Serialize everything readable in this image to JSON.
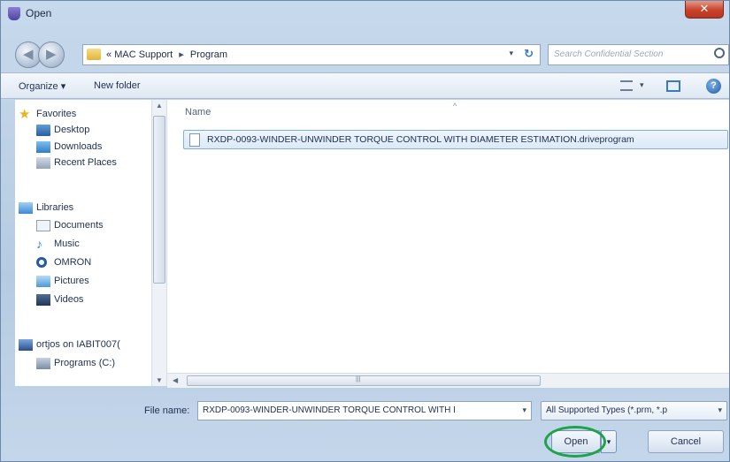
{
  "window": {
    "title": "Open",
    "close_glyph": "✕"
  },
  "nav": {
    "back_glyph": "◀",
    "forward_glyph": "▶",
    "breadcrumb": [
      "«",
      "MAC Support",
      "Program"
    ],
    "breadcrumb_sep": "▸",
    "address_dropdown": "▾",
    "refresh_glyph": "↻",
    "search_placeholder": "Search Confidential Section"
  },
  "toolbar": {
    "organize": "Organize ▾",
    "new_folder": "New folder",
    "view_dropdown": "▾",
    "help_glyph": "?"
  },
  "sidebar": {
    "favorites": {
      "label": "Favorites",
      "icon": "star-icon"
    },
    "favorite_items": [
      {
        "label": "Desktop",
        "icon": "desktop-icon"
      },
      {
        "label": "Downloads",
        "icon": "downloads-icon"
      },
      {
        "label": "Recent Places",
        "icon": "recent-places-icon"
      }
    ],
    "libraries": {
      "label": "Libraries",
      "icon": "libraries-icon"
    },
    "library_items": [
      {
        "label": "Documents",
        "icon": "documents-icon"
      },
      {
        "label": "Music",
        "icon": "music-icon"
      },
      {
        "label": "OMRON",
        "icon": "omron-icon"
      },
      {
        "label": "Pictures",
        "icon": "pictures-icon"
      },
      {
        "label": "Videos",
        "icon": "videos-icon"
      }
    ],
    "network": {
      "label": "ortjos on IABIT007(",
      "icon": "network-icon"
    },
    "drive": {
      "label": "Programs (C:)",
      "icon": "drive-icon"
    }
  },
  "file_list": {
    "column_name": "Name",
    "sort_glyph": "^",
    "files": [
      {
        "name": "RXDP-0093-WINDER-UNWINDER TORQUE CONTROL WITH DIAMETER ESTIMATION.driveprogram"
      }
    ]
  },
  "scroll": {
    "up": "▲",
    "down": "▼",
    "left": "◀",
    "grip": "|||"
  },
  "bottom": {
    "file_name_label": "File name:",
    "file_name_value": "RXDP-0093-WINDER-UNWINDER TORQUE CONTROL WITH I",
    "file_type_value": "All Supported Types (*.prm, *.p",
    "dropdown_glyph": "▾",
    "open_label": "Open",
    "open_split_glyph": "▾",
    "cancel_label": "Cancel"
  },
  "colors": {
    "highlight_ring": "#1fa34a",
    "selection": "#dbe9f8"
  }
}
